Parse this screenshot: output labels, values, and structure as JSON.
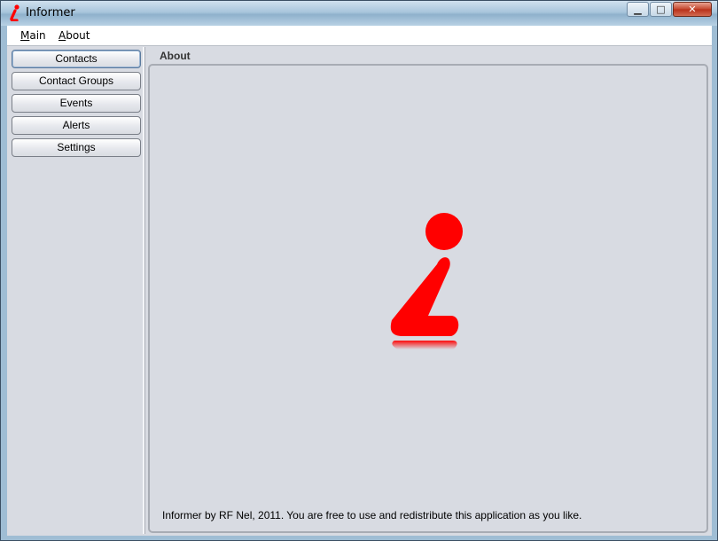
{
  "window": {
    "title": "Informer",
    "controls": {
      "minimize": "▁",
      "maximize": "□",
      "close": "✕"
    }
  },
  "menu": [
    {
      "label": "Main",
      "mnemonic": "M",
      "rest": "ain"
    },
    {
      "label": "About",
      "mnemonic": "A",
      "rest": "bout"
    }
  ],
  "sidebar": {
    "items": [
      {
        "label": "Contacts",
        "active": true
      },
      {
        "label": "Contact Groups",
        "active": false
      },
      {
        "label": "Events",
        "active": false
      },
      {
        "label": "Alerts",
        "active": false
      },
      {
        "label": "Settings",
        "active": false
      }
    ]
  },
  "panel": {
    "title": "About",
    "logo": "info-i-logo",
    "logo_color": "#ff0000",
    "text": "Informer by RF Nel, 2011.  You are free to use and redistribute this application as you like."
  }
}
